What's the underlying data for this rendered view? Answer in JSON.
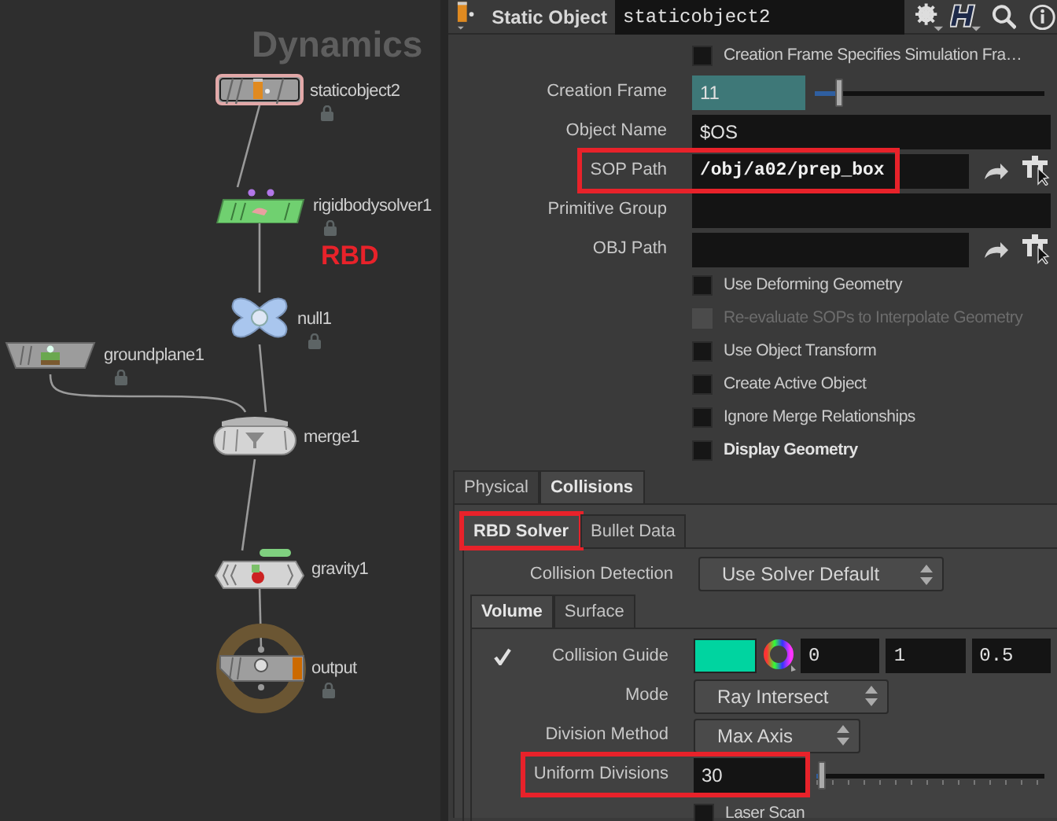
{
  "network": {
    "title": "Dynamics",
    "annotation": "RBD",
    "nodes": [
      {
        "name": "staticobject2",
        "kind": "object",
        "selected": true,
        "locked": true
      },
      {
        "name": "rigidbodysolver1",
        "kind": "solver",
        "selected": false,
        "locked": true
      },
      {
        "name": "null1",
        "kind": "null",
        "selected": false,
        "locked": true
      },
      {
        "name": "groundplane1",
        "kind": "groundplane",
        "selected": false,
        "locked": true
      },
      {
        "name": "merge1",
        "kind": "merge",
        "selected": false,
        "locked": false
      },
      {
        "name": "gravity1",
        "kind": "force",
        "selected": false,
        "locked": false
      },
      {
        "name": "output",
        "kind": "output",
        "selected": false,
        "locked": true
      }
    ]
  },
  "parameters": {
    "node_type": "Static Object",
    "node_name": "staticobject2",
    "top": [
      {
        "kind": "toggle",
        "label": "Creation Frame Specifies Simulation Fra…",
        "checked": false,
        "disabled": false,
        "bold": false
      },
      {
        "kind": "slider",
        "label": "Creation Frame",
        "value": "11",
        "level": 0.1,
        "highlighted": false,
        "animated": true
      },
      {
        "kind": "text",
        "label": "Object Name",
        "value": "$OS",
        "highlighted": false
      },
      {
        "kind": "path",
        "label": "SOP Path",
        "value": "/obj/a02/prep_box",
        "highlighted": true
      },
      {
        "kind": "text",
        "label": "Primitive Group",
        "highlighted": false
      },
      {
        "kind": "path",
        "label": "OBJ Path",
        "highlighted": false
      },
      {
        "kind": "toggle",
        "label": "Use Deforming Geometry",
        "checked": false,
        "disabled": false,
        "bold": false
      },
      {
        "kind": "toggle",
        "label": "Re-evaluate SOPs to Interpolate Geometry",
        "checked": false,
        "disabled": true,
        "bold": false
      },
      {
        "kind": "toggle",
        "label": "Use Object Transform",
        "checked": false,
        "disabled": false,
        "bold": false
      },
      {
        "kind": "toggle",
        "label": "Create Active Object",
        "checked": false,
        "disabled": false,
        "bold": false
      },
      {
        "kind": "toggle",
        "label": "Ignore Merge Relationships",
        "checked": false,
        "disabled": false,
        "bold": false
      },
      {
        "kind": "toggle",
        "label": "Display Geometry",
        "checked": false,
        "disabled": false,
        "bold": true
      }
    ],
    "tabs": [
      {
        "label": "Physical",
        "selected": false
      },
      {
        "label": "Collisions",
        "selected": true
      }
    ],
    "subtabs": [
      {
        "label": "RBD Solver",
        "selected": true,
        "highlighted": true
      },
      {
        "label": "Bullet Data",
        "selected": false,
        "highlighted": false
      }
    ],
    "solver": [
      {
        "kind": "menu",
        "label": "Collision Detection",
        "value": "Use Solver Default"
      }
    ],
    "volume_tabs": [
      {
        "label": "Volume",
        "selected": true
      },
      {
        "label": "Surface",
        "selected": false
      }
    ],
    "volume": [
      {
        "kind": "color",
        "label": "Collision Guide",
        "checked": true,
        "color": "#00d4a0",
        "values": [
          "0",
          "1",
          "0.5"
        ]
      },
      {
        "kind": "menu",
        "label": "Mode",
        "value": "Ray Intersect"
      },
      {
        "kind": "menu",
        "label": "Division Method",
        "value": "Max Axis"
      },
      {
        "kind": "slider",
        "label": "Uniform Divisions",
        "value": "30",
        "level": 0.02,
        "highlighted": true,
        "animated": false
      },
      {
        "kind": "toggle",
        "label": "Laser Scan",
        "checked": false,
        "disabled": false,
        "bold": false
      }
    ]
  }
}
